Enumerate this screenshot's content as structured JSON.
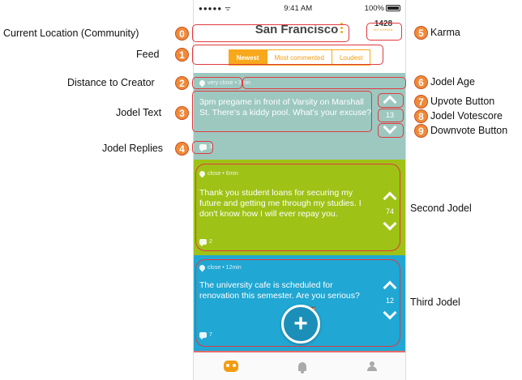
{
  "status_bar": {
    "signal": "●●●●● ᯤ",
    "time": "9:41 AM",
    "battery": "100%"
  },
  "header": {
    "location": "San Francisco",
    "karma_value": "1428",
    "karma_label": "MY KARMA"
  },
  "feed_tabs": [
    {
      "label": "Newest",
      "active": true
    },
    {
      "label": "Most commented",
      "active": false
    },
    {
      "label": "Loudest",
      "active": false
    }
  ],
  "jodels": [
    {
      "meta": "very close • 3min",
      "text": "3pm pregame in front of Varsity on Marshall St. There's a kiddy pool. What's your excuse?",
      "score": "13",
      "replies": "3",
      "color": "#9cc8c0"
    },
    {
      "meta": "close • 6min",
      "text": "Thank you student loans for securing my future and getting me through my studies. I don't know how I will ever repay you.",
      "score": "74",
      "replies": "2",
      "color": "#9ec216"
    },
    {
      "meta": "close • 12min",
      "text": "The university cafe is scheduled for renovation this semester. Are you serious?",
      "score": "12",
      "replies": "7",
      "color": "#20a7d3"
    }
  ],
  "fab": {
    "label": "+",
    "emojis": "🦉🦉🦉"
  },
  "tab_bar": {
    "home_icon": "owl-icon",
    "notifications_icon": "bell-icon",
    "profile_icon": "user-icon",
    "accent": "#f39c12"
  },
  "annotations": {
    "n0": "0",
    "l0": "Current Location (Community)",
    "n1": "1",
    "l1": "Feed",
    "n2": "2",
    "l2": "Distance to Creator",
    "n3": "3",
    "l3": "Jodel Text",
    "n4": "4",
    "l4": "Jodel Replies",
    "n5": "5",
    "l5": "Karma",
    "n6": "6",
    "l6": "Jodel Age",
    "n7": "7",
    "l7": "Upvote Button",
    "n8": "8",
    "l8": "Jodel Votescore",
    "n9": "9",
    "l9": "Downvote Button",
    "second": "Second Jodel",
    "third": "Third Jodel"
  }
}
